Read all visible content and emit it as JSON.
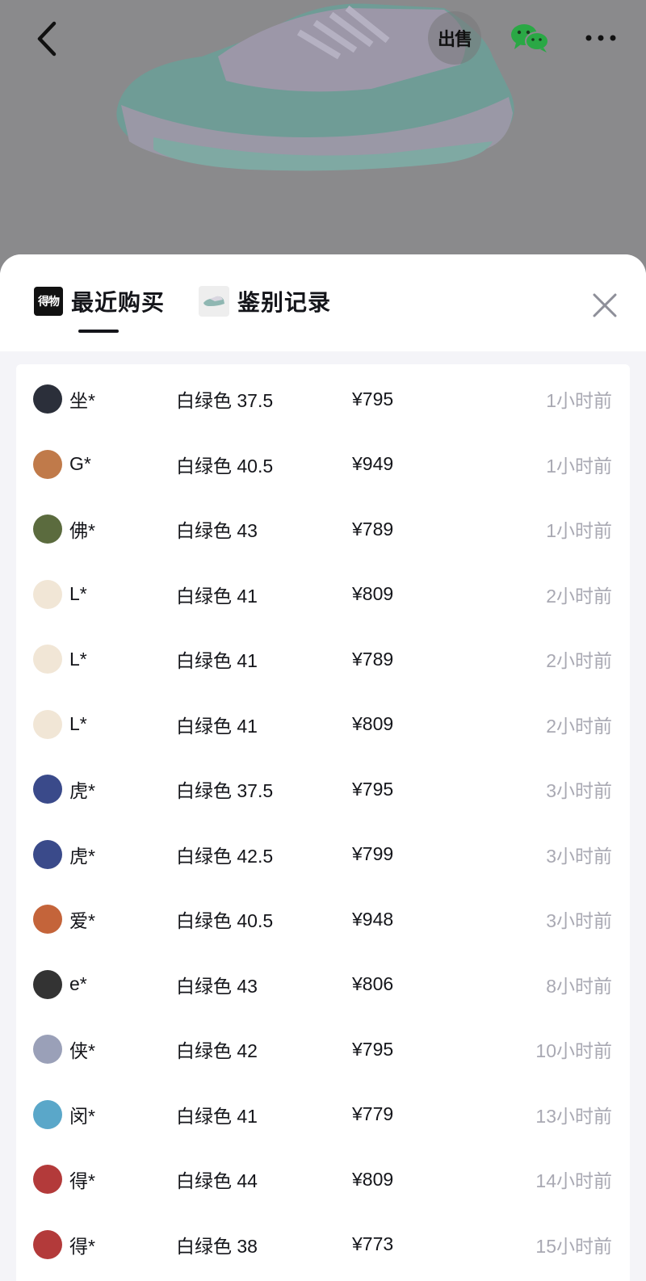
{
  "header": {
    "sell_label": "出售",
    "icons": [
      "back-icon",
      "sell-icon",
      "wechat-icon",
      "more-icon"
    ]
  },
  "sheet": {
    "tabs": [
      {
        "label": "最近购买",
        "icon": "du-logo-icon",
        "logo_text": "得物",
        "active": true
      },
      {
        "label": "鉴别记录",
        "icon": "shoe-thumbnail-icon",
        "active": false
      }
    ],
    "close_icon": "close-icon"
  },
  "records": [
    {
      "name": "坐*",
      "spec": "白绿色 37.5",
      "price": "¥795",
      "time": "1小时前",
      "avatar_color": "#2b2f3a"
    },
    {
      "name": "G*",
      "spec": "白绿色 40.5",
      "price": "¥949",
      "time": "1小时前",
      "avatar_color": "#c07a4a"
    },
    {
      "name": "佛*",
      "spec": "白绿色 43",
      "price": "¥789",
      "time": "1小时前",
      "avatar_color": "#5b6b3e"
    },
    {
      "name": "L*",
      "spec": "白绿色 41",
      "price": "¥809",
      "time": "2小时前",
      "avatar_color": "#f1e6d6"
    },
    {
      "name": "L*",
      "spec": "白绿色 41",
      "price": "¥789",
      "time": "2小时前",
      "avatar_color": "#f1e6d6"
    },
    {
      "name": "L*",
      "spec": "白绿色 41",
      "price": "¥809",
      "time": "2小时前",
      "avatar_color": "#f1e6d6"
    },
    {
      "name": "虎*",
      "spec": "白绿色 37.5",
      "price": "¥795",
      "time": "3小时前",
      "avatar_color": "#3a4a8a"
    },
    {
      "name": "虎*",
      "spec": "白绿色 42.5",
      "price": "¥799",
      "time": "3小时前",
      "avatar_color": "#3a4a8a"
    },
    {
      "name": "爱*",
      "spec": "白绿色 40.5",
      "price": "¥948",
      "time": "3小时前",
      "avatar_color": "#c4643a"
    },
    {
      "name": "e*",
      "spec": "白绿色 43",
      "price": "¥806",
      "time": "8小时前",
      "avatar_color": "#333333"
    },
    {
      "name": "侠*",
      "spec": "白绿色 42",
      "price": "¥795",
      "time": "10小时前",
      "avatar_color": "#9aa0b8"
    },
    {
      "name": "闵*",
      "spec": "白绿色 41",
      "price": "¥779",
      "time": "13小时前",
      "avatar_color": "#5aa7c9"
    },
    {
      "name": "得*",
      "spec": "白绿色 44",
      "price": "¥809",
      "time": "14小时前",
      "avatar_color": "#b33a3a"
    },
    {
      "name": "得*",
      "spec": "白绿色 38",
      "price": "¥773",
      "time": "15小时前",
      "avatar_color": "#b33a3a"
    }
  ],
  "colors": {
    "overlay": "#8a8a8c",
    "text_primary": "#14151a",
    "text_secondary": "#a9a9b3",
    "wechat_green": "#2aa845"
  }
}
